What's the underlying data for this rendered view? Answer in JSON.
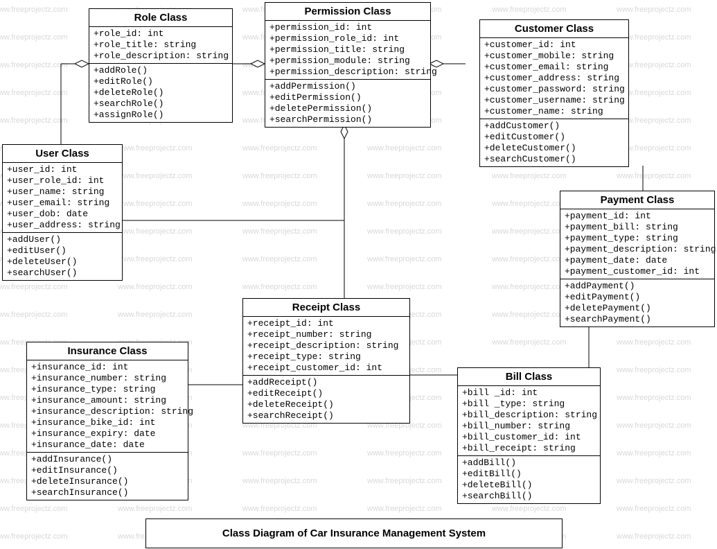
{
  "watermark_text": "www.freeprojectz.com",
  "diagram_title": "Class Diagram of Car Insurance Management System",
  "classes": {
    "role": {
      "title": "Role Class",
      "attrs": [
        "+role_id: int",
        "+role_title: string",
        "+role_description: string"
      ],
      "meths": [
        "+addRole()",
        "+editRole()",
        "+deleteRole()",
        "+searchRole()",
        "+assignRole()"
      ]
    },
    "permission": {
      "title": "Permission Class",
      "attrs": [
        "+permission_id: int",
        "+permission_role_id: int",
        "+permission_title: string",
        "+permission_module: string",
        "+permission_description: string"
      ],
      "meths": [
        "+addPermission()",
        "+editPermission()",
        "+deletePermission()",
        "+searchPermission()"
      ]
    },
    "customer": {
      "title": "Customer Class",
      "attrs": [
        "+customer_id: int",
        "+customer_mobile: string",
        "+customer_email: string",
        "+customer_address: string",
        "+customer_password: string",
        "+customer_username: string",
        "+customer_name: string"
      ],
      "meths": [
        "+addCustomer()",
        "+editCustomer()",
        "+deleteCustomer()",
        "+searchCustomer()"
      ]
    },
    "user": {
      "title": "User Class",
      "attrs": [
        "+user_id: int",
        "+user_role_id: int",
        "+user_name: string",
        "+user_email: string",
        "+user_dob: date",
        "+user_address: string"
      ],
      "meths": [
        "+addUser()",
        "+editUser()",
        "+deleteUser()",
        "+searchUser()"
      ]
    },
    "payment": {
      "title": "Payment Class",
      "attrs": [
        "+payment_id: int",
        "+payment_bill: string",
        "+payment_type: string",
        "+payment_description: string",
        "+payment_date: date",
        "+payment_customer_id: int"
      ],
      "meths": [
        "+addPayment()",
        "+editPayment()",
        "+deletePayment()",
        "+searchPayment()"
      ]
    },
    "receipt": {
      "title": "Receipt Class",
      "attrs": [
        "+receipt_id: int",
        "+receipt_number: string",
        "+receipt_description: string",
        "+receipt_type: string",
        "+receipt_customer_id: int"
      ],
      "meths": [
        "+addReceipt()",
        "+editReceipt()",
        "+deleteReceipt()",
        "+searchReceipt()"
      ]
    },
    "insurance": {
      "title": "Insurance Class",
      "attrs": [
        "+insurance_id: int",
        "+insurance_number: string",
        "+insurance_type: string",
        "+insurance_amount: string",
        "+insurance_description: string",
        "+insurance_bike_id: int",
        "+insurance_expiry: date",
        "+insurance_date: date"
      ],
      "meths": [
        "+addInsurance()",
        "+editInsurance()",
        "+deleteInsurance()",
        "+searchInsurance()"
      ]
    },
    "bill": {
      "title": "Bill Class",
      "attrs": [
        "+bill _id: int",
        "+bill _type: string",
        "+bill_description: string",
        "+bill_number: string",
        "+bill_customer_id: int",
        "+bill_receipt: string"
      ],
      "meths": [
        "+addBill()",
        "+editBill()",
        "+deleteBill()",
        "+searchBill()"
      ]
    }
  }
}
